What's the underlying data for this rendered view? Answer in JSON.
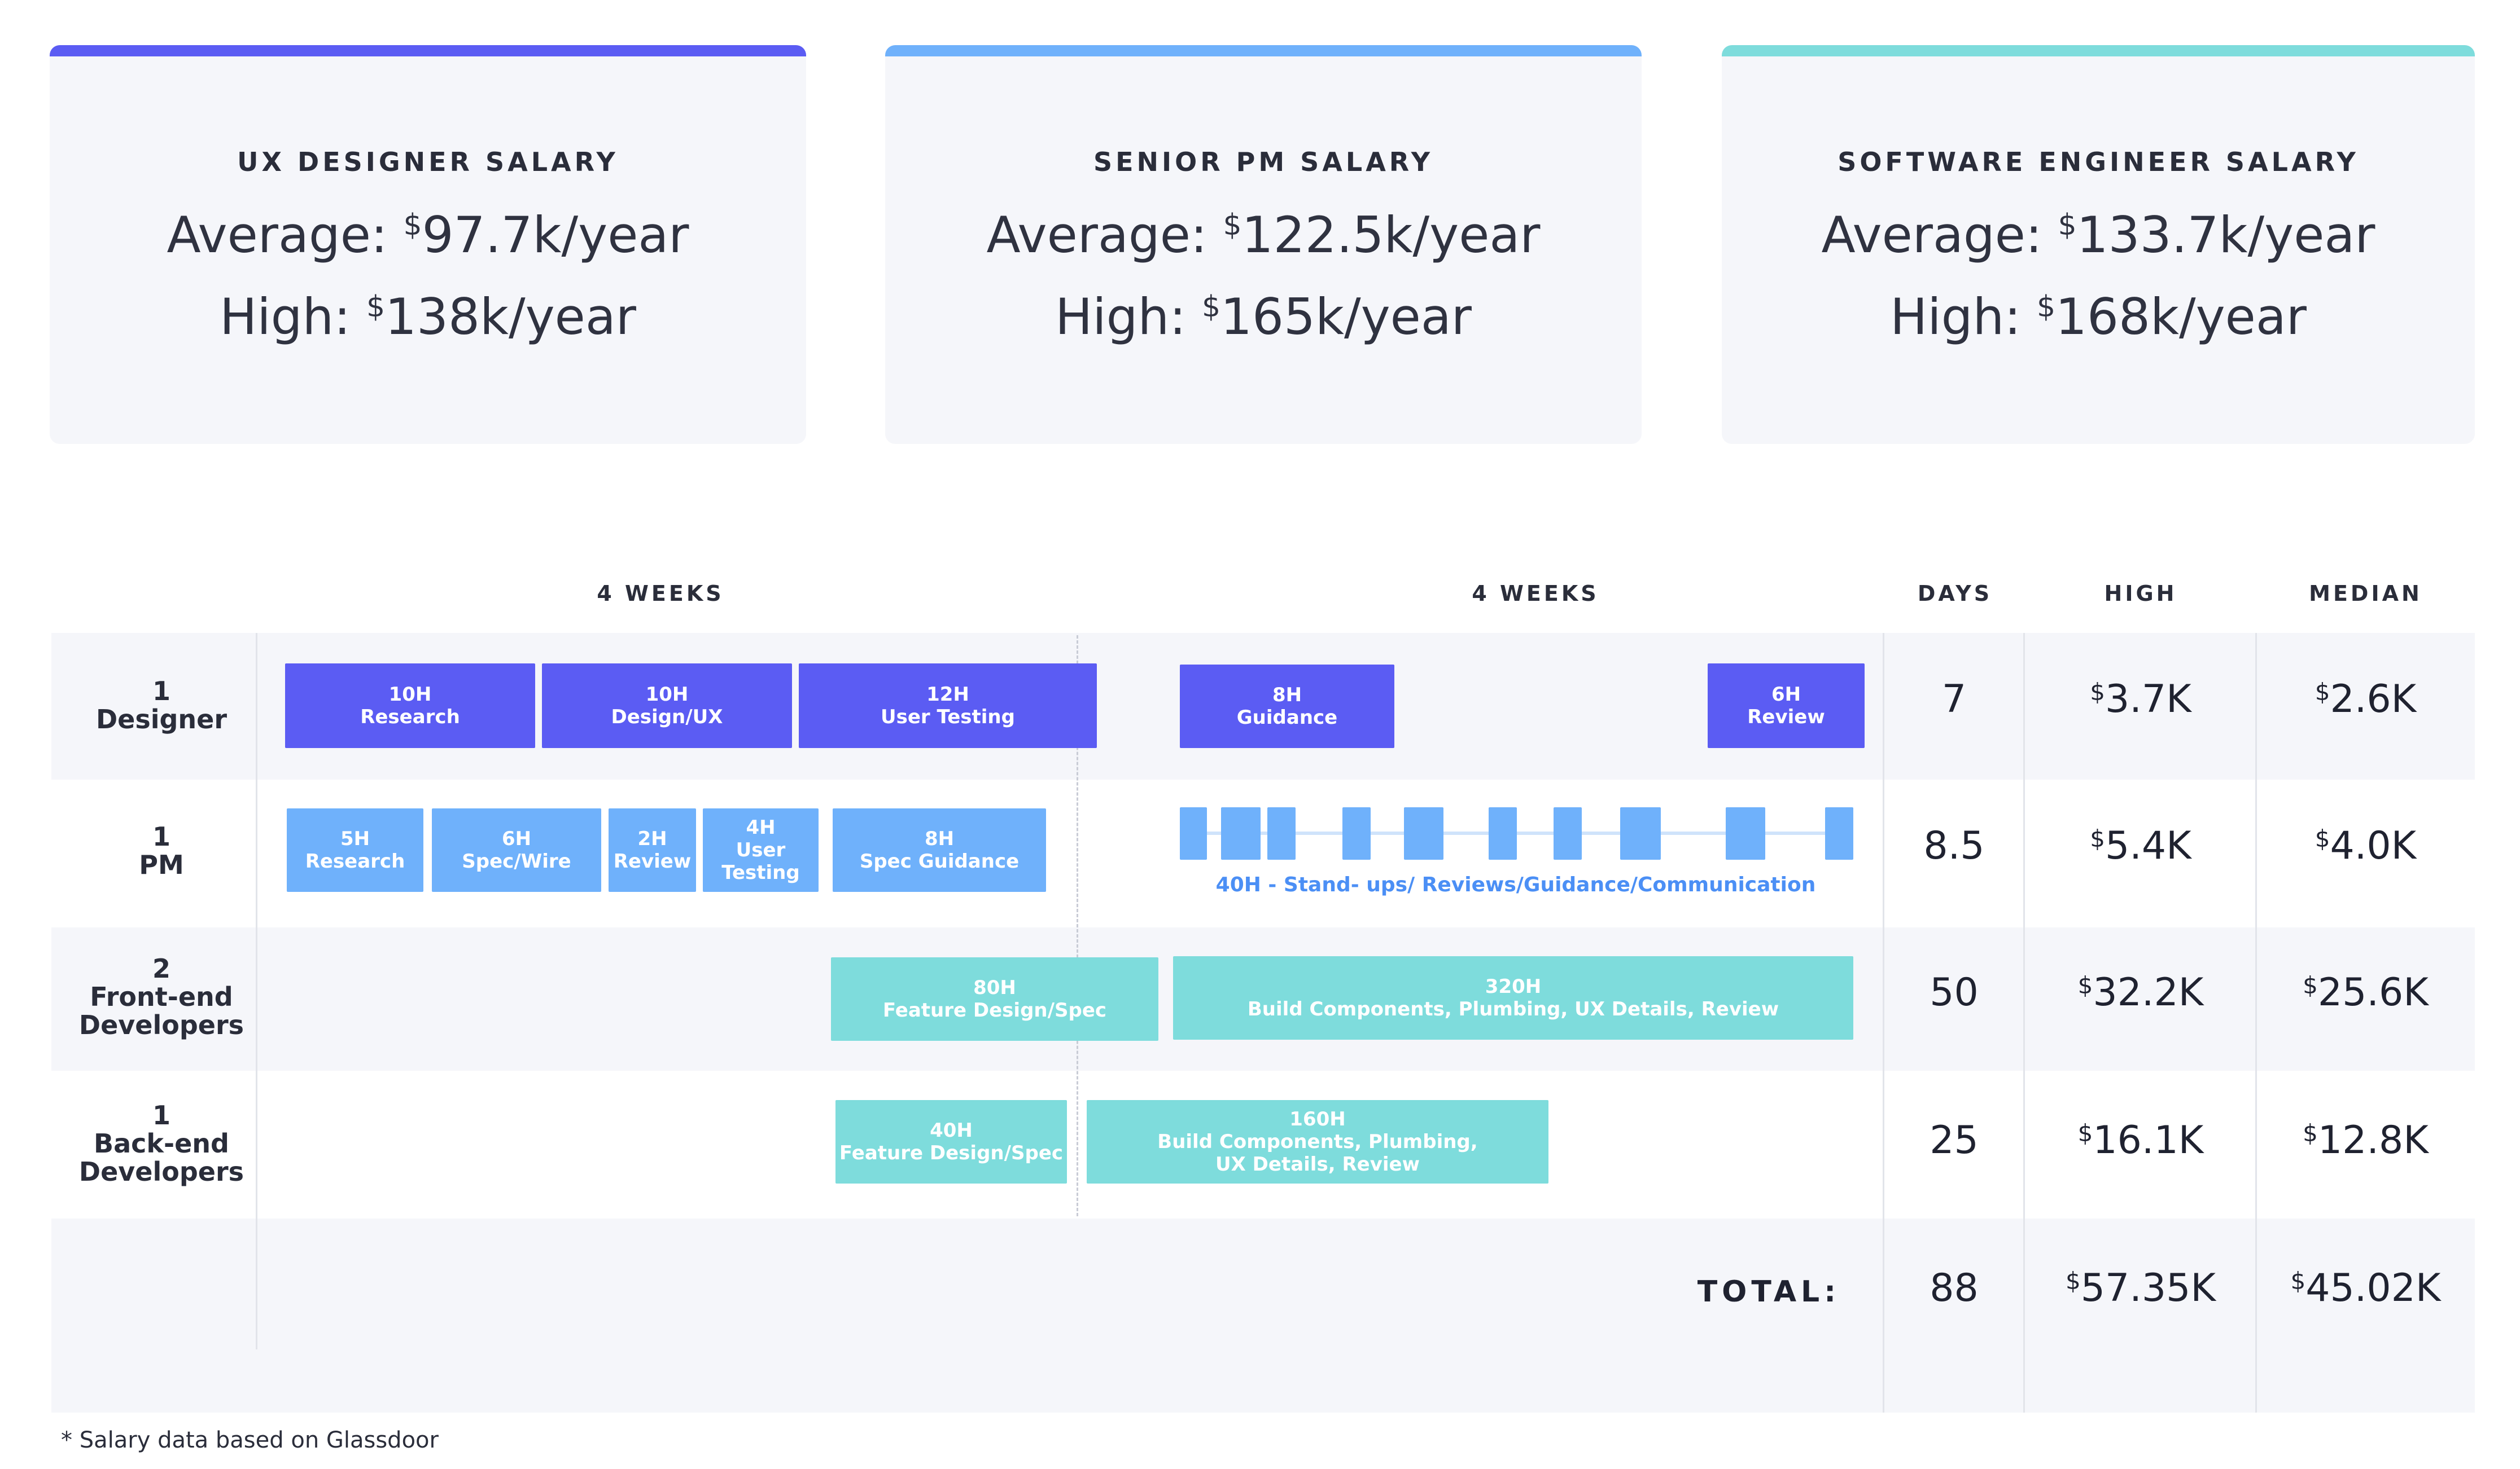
{
  "colors": {
    "designer": "#5b5cf3",
    "pm": "#6fb1fb",
    "engineer": "#7edcdc"
  },
  "cards": [
    {
      "title": "UX DESIGNER SALARY",
      "avg_prefix": "Average: ",
      "avg_value": "97.7k/year",
      "high_prefix": "High: ",
      "high_value": "138k/year",
      "currency": "$"
    },
    {
      "title": "SENIOR PM SALARY",
      "avg_prefix": "Average: ",
      "avg_value": "122.5k/year",
      "high_prefix": "High: ",
      "high_value": "165k/year",
      "currency": "$"
    },
    {
      "title": "SOFTWARE ENGINEER SALARY",
      "avg_prefix": "Average: ",
      "avg_value": "133.7k/year",
      "high_prefix": "High: ",
      "high_value": "168k/year",
      "currency": "$"
    }
  ],
  "headers": {
    "weeks_1": "4 WEEKS",
    "weeks_2": "4 WEEKS",
    "days": "DAYS",
    "high": "HIGH",
    "median": "MEDIAN"
  },
  "rows": [
    {
      "count": "1",
      "role": "Designer",
      "days": "7",
      "high": "3.7K",
      "median": "2.6K"
    },
    {
      "count": "1",
      "role": "PM",
      "days": "8.5",
      "high": "5.4K",
      "median": "4.0K"
    },
    {
      "count": "2",
      "role": "Front-end",
      "role2": "Developers",
      "days": "50",
      "high": "32.2K",
      "median": "25.6K"
    },
    {
      "count": "1",
      "role": "Back-end",
      "role2": "Developers",
      "days": "25",
      "high": "16.1K",
      "median": "12.8K"
    }
  ],
  "currency": "$",
  "tasks": {
    "designer": [
      {
        "hours": "10H",
        "label": "Research"
      },
      {
        "hours": "10H",
        "label": "Design/UX"
      },
      {
        "hours": "12H",
        "label": "User Testing"
      },
      {
        "hours": "8H",
        "label": "Guidance"
      },
      {
        "hours": "6H",
        "label": "Review"
      }
    ],
    "pm": [
      {
        "hours": "5H",
        "label": "Research"
      },
      {
        "hours": "6H",
        "label": "Spec/Wire"
      },
      {
        "hours": "2H",
        "label": "Review"
      },
      {
        "hours": "4H",
        "label": "User",
        "label2": "Testing"
      },
      {
        "hours": "8H",
        "label": "Spec Guidance"
      }
    ],
    "pm_ongoing": "40H - Stand- ups/ Reviews/Guidance/Communication",
    "frontend": [
      {
        "hours": "80H",
        "label": "Feature Design/Spec"
      },
      {
        "hours": "320H",
        "label": "Build Components, Plumbing, UX Details, Review"
      }
    ],
    "backend": [
      {
        "hours": "40H",
        "label": "Feature Design/Spec"
      },
      {
        "hours": "160H",
        "label": "Build Components, Plumbing,",
        "label2": "UX Details, Review"
      }
    ]
  },
  "total": {
    "label": "TOTAL:",
    "days": "88",
    "high": "57.35K",
    "median": "45.02K"
  },
  "footnote": "* Salary data based on Glassdoor"
}
